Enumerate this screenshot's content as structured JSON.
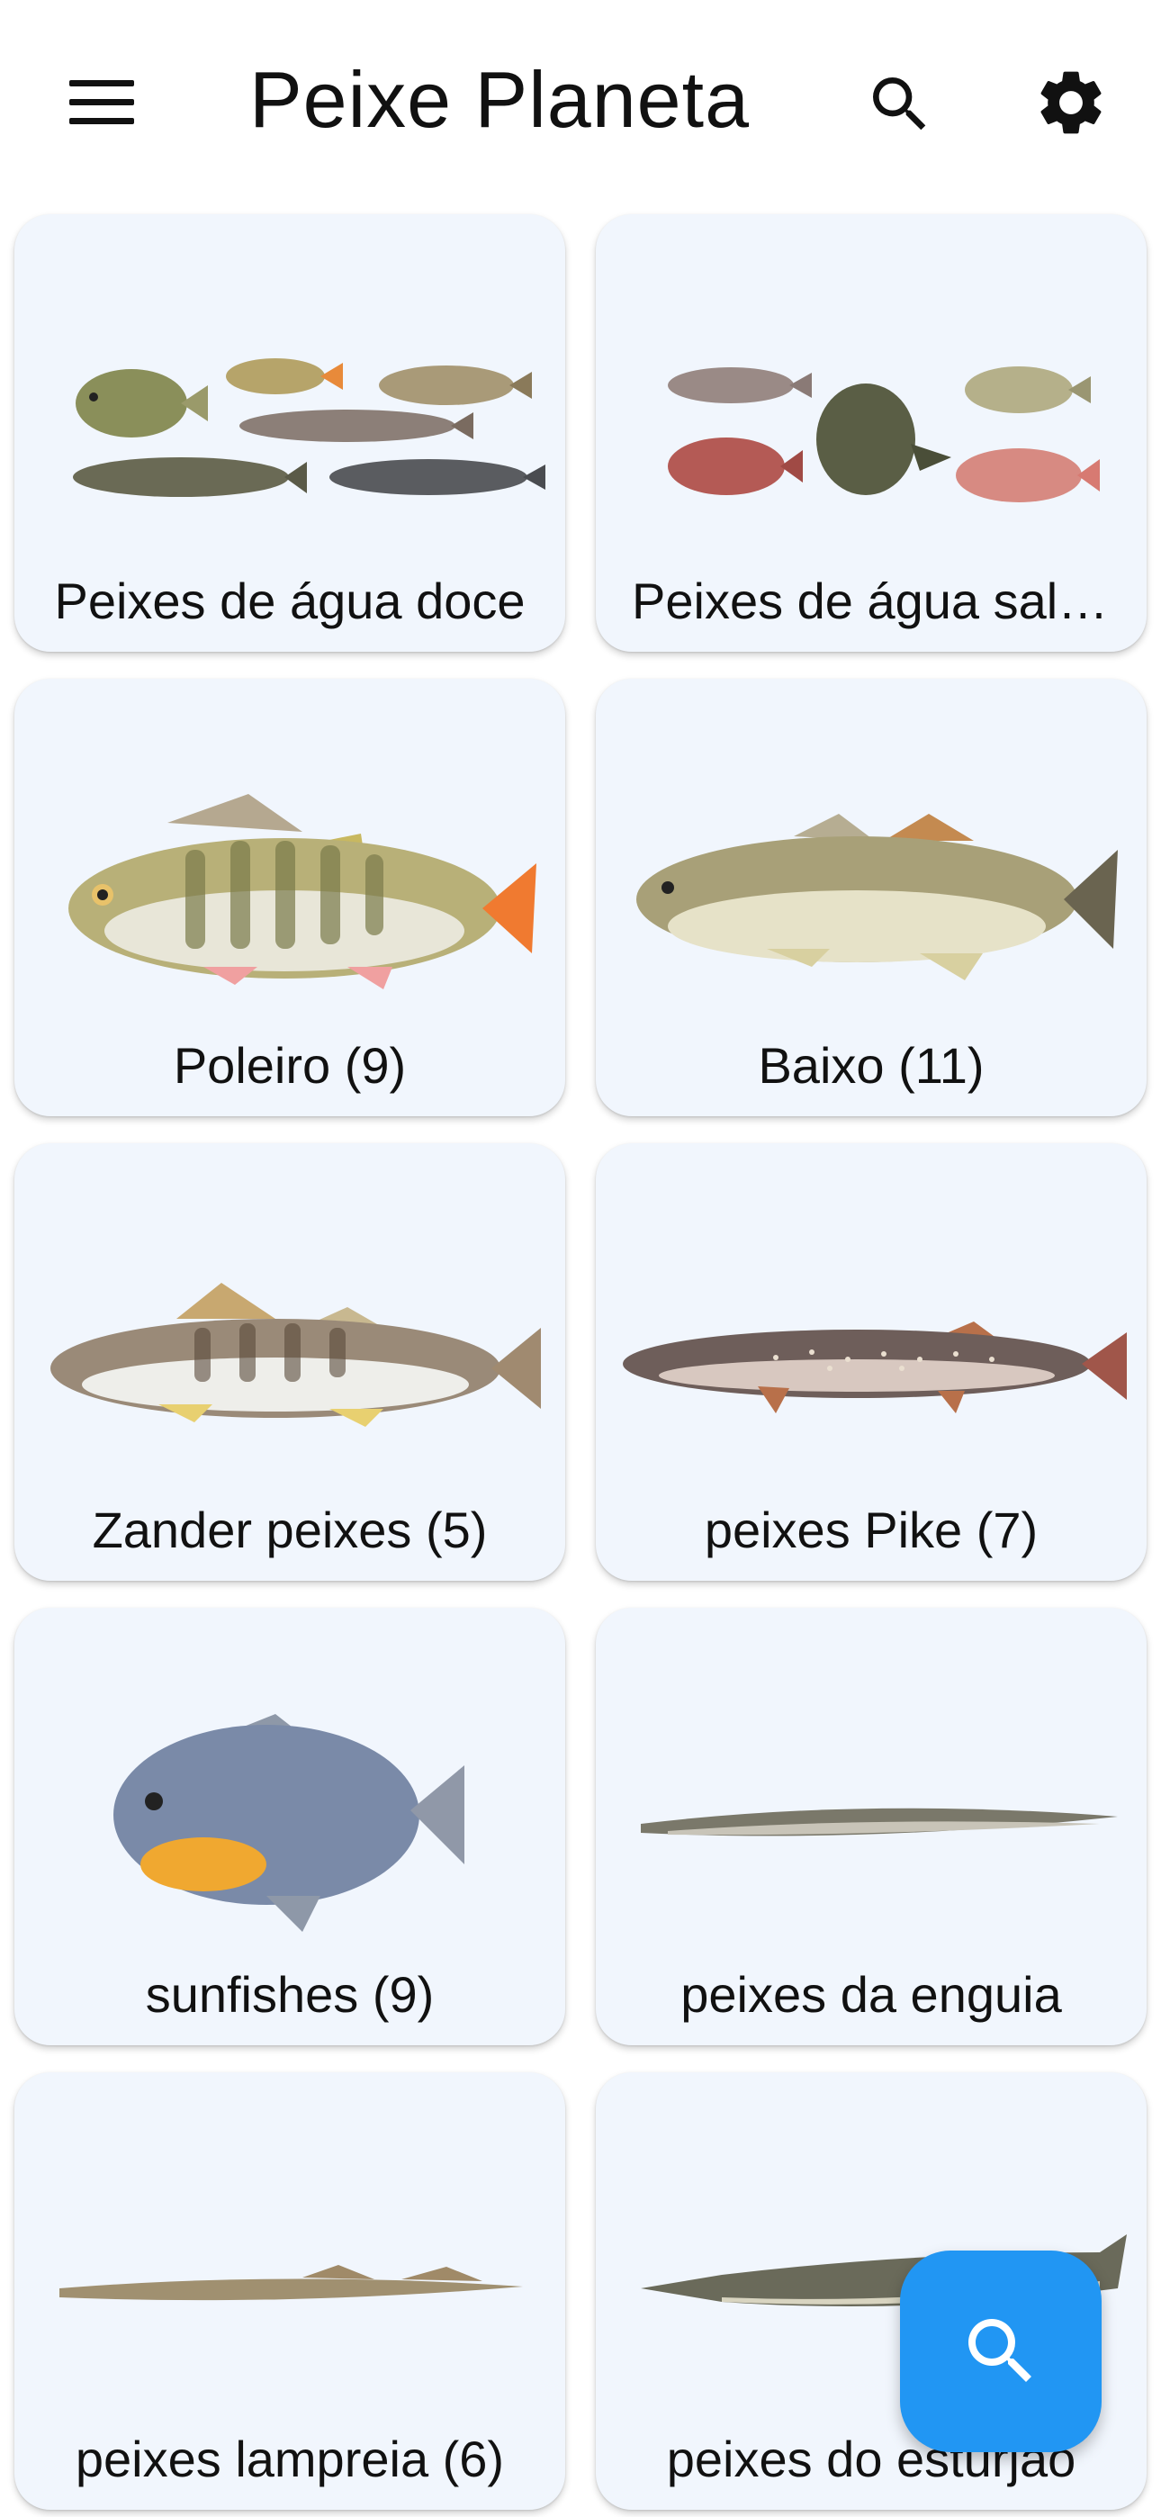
{
  "appbar": {
    "title": "Peixe Planeta",
    "menu_icon": "menu-icon",
    "search_icon": "search-icon",
    "settings_icon": "gear-icon"
  },
  "categories": [
    {
      "label": "Peixes de água doce",
      "image": "freshwater-fish-group"
    },
    {
      "label": "Peixes de água salgada",
      "image": "saltwater-fish-group"
    },
    {
      "label": "Poleiro (9)",
      "image": "perch-fish"
    },
    {
      "label": "Baixo (11)",
      "image": "bass-fish"
    },
    {
      "label": "Zander peixes (5)",
      "image": "zander-fish"
    },
    {
      "label": "peixes Pike (7)",
      "image": "pike-fish"
    },
    {
      "label": "sunfishes (9)",
      "image": "sunfish"
    },
    {
      "label": "peixes da enguia",
      "image": "eel-fish"
    },
    {
      "label": "peixes lampreia (6)",
      "image": "lamprey-fish"
    },
    {
      "label": "peixes do esturjão",
      "image": "sturgeon-fish"
    }
  ],
  "fab": {
    "icon": "search-icon"
  },
  "colors": {
    "card_bg": "#f1f6fd",
    "fab_bg": "#2196f3",
    "text": "#111111"
  }
}
